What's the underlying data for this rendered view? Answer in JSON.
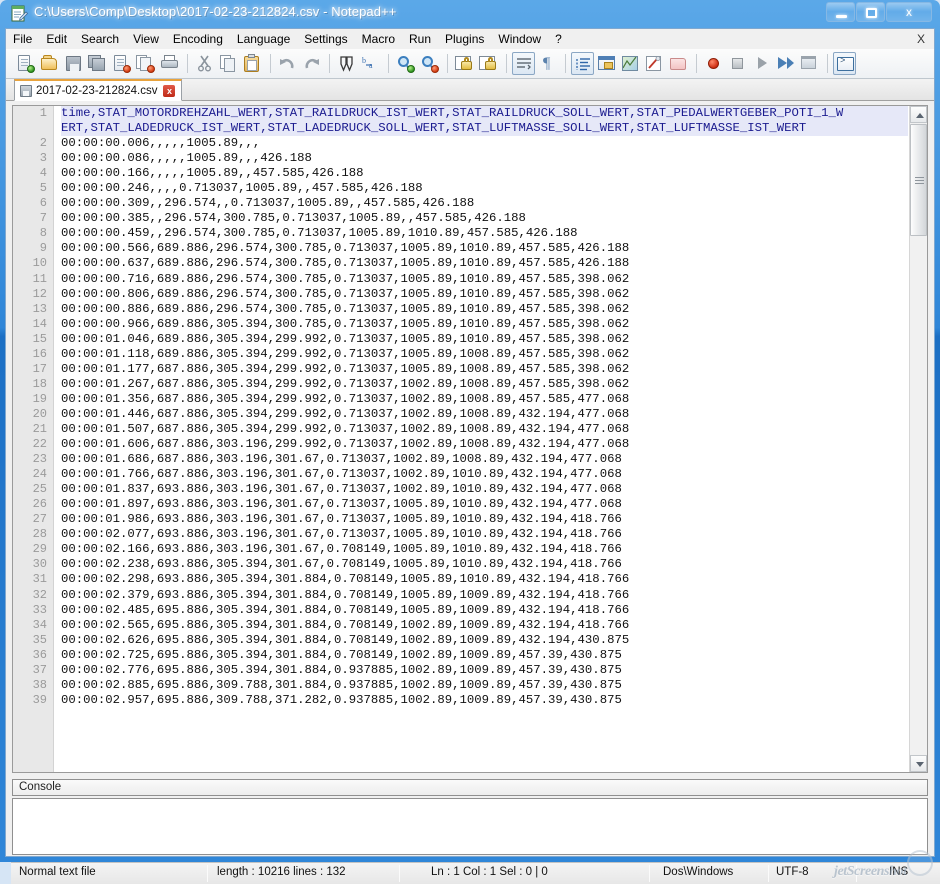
{
  "window": {
    "title": "C:\\Users\\Comp\\Desktop\\2017-02-23-212824.csv - Notepad++",
    "minimize_label": "",
    "maximize_label": "",
    "close_label": "x"
  },
  "menu": {
    "items": [
      {
        "label": "File"
      },
      {
        "label": "Edit"
      },
      {
        "label": "Search"
      },
      {
        "label": "View"
      },
      {
        "label": "Encoding"
      },
      {
        "label": "Language"
      },
      {
        "label": "Settings"
      },
      {
        "label": "Macro"
      },
      {
        "label": "Run"
      },
      {
        "label": "Plugins"
      },
      {
        "label": "Window"
      },
      {
        "label": "?"
      }
    ],
    "close_document_label": "X"
  },
  "toolbar": {
    "icons": [
      "new-file-icon",
      "open-file-icon",
      "save-icon",
      "save-all-icon",
      "close-file-icon",
      "close-all-icon",
      "print-icon",
      "cut-icon",
      "copy-icon",
      "paste-icon",
      "undo-icon",
      "redo-icon",
      "find-icon",
      "replace-icon",
      "zoom-in-icon",
      "zoom-out-icon",
      "sync-vertical-scroll-icon",
      "sync-horizontal-scroll-icon",
      "word-wrap-icon",
      "show-all-characters-icon",
      "indent-guide-icon",
      "user-defined-dialog-icon",
      "document-map-icon",
      "function-list-icon",
      "folder-as-workspace-icon",
      "record-macro-icon",
      "stop-recording-icon",
      "playback-macro-icon",
      "run-macro-multiple-icon",
      "save-macro-icon",
      "run-console-icon"
    ]
  },
  "tab": {
    "label": "2017-02-23-212824.csv",
    "icon": "saved-document-icon",
    "close_label": "x"
  },
  "editor": {
    "line_numbers": [
      1,
      2,
      3,
      4,
      5,
      6,
      7,
      8,
      9,
      10,
      11,
      12,
      13,
      14,
      15,
      16,
      17,
      18,
      19,
      20,
      21,
      22,
      23,
      24,
      25,
      26,
      27,
      28,
      29,
      30,
      31,
      32,
      33,
      34,
      35,
      36,
      37,
      38,
      39
    ],
    "header_line_1": "time,STAT_MOTORDREHZAHL_WERT,STAT_RAILDRUCK_IST_WERT,STAT_RAILDRUCK_SOLL_WERT,STAT_PEDALWERTGEBER_POTI_1_W",
    "header_line_2": "ERT,STAT_LADEDRUCK_IST_WERT,STAT_LADEDRUCK_SOLL_WERT,STAT_LUFTMASSE_SOLL_WERT,STAT_LUFTMASSE_IST_WERT",
    "lines": [
      "00:00:00.006,,,,,1005.89,,,",
      "00:00:00.086,,,,,1005.89,,,426.188",
      "00:00:00.166,,,,,1005.89,,457.585,426.188",
      "00:00:00.246,,,,0.713037,1005.89,,457.585,426.188",
      "00:00:00.309,,296.574,,0.713037,1005.89,,457.585,426.188",
      "00:00:00.385,,296.574,300.785,0.713037,1005.89,,457.585,426.188",
      "00:00:00.459,,296.574,300.785,0.713037,1005.89,1010.89,457.585,426.188",
      "00:00:00.566,689.886,296.574,300.785,0.713037,1005.89,1010.89,457.585,426.188",
      "00:00:00.637,689.886,296.574,300.785,0.713037,1005.89,1010.89,457.585,426.188",
      "00:00:00.716,689.886,296.574,300.785,0.713037,1005.89,1010.89,457.585,398.062",
      "00:00:00.806,689.886,296.574,300.785,0.713037,1005.89,1010.89,457.585,398.062",
      "00:00:00.886,689.886,296.574,300.785,0.713037,1005.89,1010.89,457.585,398.062",
      "00:00:00.966,689.886,305.394,300.785,0.713037,1005.89,1010.89,457.585,398.062",
      "00:00:01.046,689.886,305.394,299.992,0.713037,1005.89,1010.89,457.585,398.062",
      "00:00:01.118,689.886,305.394,299.992,0.713037,1005.89,1008.89,457.585,398.062",
      "00:00:01.177,687.886,305.394,299.992,0.713037,1005.89,1008.89,457.585,398.062",
      "00:00:01.267,687.886,305.394,299.992,0.713037,1002.89,1008.89,457.585,398.062",
      "00:00:01.356,687.886,305.394,299.992,0.713037,1002.89,1008.89,457.585,477.068",
      "00:00:01.446,687.886,305.394,299.992,0.713037,1002.89,1008.89,432.194,477.068",
      "00:00:01.507,687.886,305.394,299.992,0.713037,1002.89,1008.89,432.194,477.068",
      "00:00:01.606,687.886,303.196,299.992,0.713037,1002.89,1008.89,432.194,477.068",
      "00:00:01.686,687.886,303.196,301.67,0.713037,1002.89,1008.89,432.194,477.068",
      "00:00:01.766,687.886,303.196,301.67,0.713037,1002.89,1010.89,432.194,477.068",
      "00:00:01.837,693.886,303.196,301.67,0.713037,1002.89,1010.89,432.194,477.068",
      "00:00:01.897,693.886,303.196,301.67,0.713037,1005.89,1010.89,432.194,477.068",
      "00:00:01.986,693.886,303.196,301.67,0.713037,1005.89,1010.89,432.194,418.766",
      "00:00:02.077,693.886,303.196,301.67,0.713037,1005.89,1010.89,432.194,418.766",
      "00:00:02.166,693.886,303.196,301.67,0.708149,1005.89,1010.89,432.194,418.766",
      "00:00:02.238,693.886,305.394,301.67,0.708149,1005.89,1010.89,432.194,418.766",
      "00:00:02.298,693.886,305.394,301.884,0.708149,1005.89,1010.89,432.194,418.766",
      "00:00:02.379,693.886,305.394,301.884,0.708149,1005.89,1009.89,432.194,418.766",
      "00:00:02.485,695.886,305.394,301.884,0.708149,1005.89,1009.89,432.194,418.766",
      "00:00:02.565,695.886,305.394,301.884,0.708149,1002.89,1009.89,432.194,418.766",
      "00:00:02.626,695.886,305.394,301.884,0.708149,1002.89,1009.89,432.194,430.875",
      "00:00:02.725,695.886,305.394,301.884,0.708149,1002.89,1009.89,457.39,430.875",
      "00:00:02.776,695.886,305.394,301.884,0.937885,1002.89,1009.89,457.39,430.875",
      "00:00:02.885,695.886,309.788,301.884,0.937885,1002.89,1009.89,457.39,430.875",
      "00:00:02.957,695.886,309.788,371.282,0.937885,1002.89,1009.89,457.39,430.875"
    ]
  },
  "console": {
    "title": "Console",
    "content": ""
  },
  "statusbar": {
    "file_type": "Normal text file",
    "length_lines": "length : 10216   lines : 132",
    "position": "Ln : 1    Col : 1    Sel : 0 | 0",
    "eol": "Dos\\Windows",
    "encoding": "UTF-8",
    "insert_mode": "INS"
  },
  "watermark": {
    "text": "jetScreenshot"
  },
  "colors": {
    "titlebar_accent": "#2f86d8",
    "header_text": "#1b1b8f",
    "header_highlight": "#e6e8f8",
    "gutter_bg": "#e8e8e8",
    "tab_active_top": "#e8a33d"
  }
}
